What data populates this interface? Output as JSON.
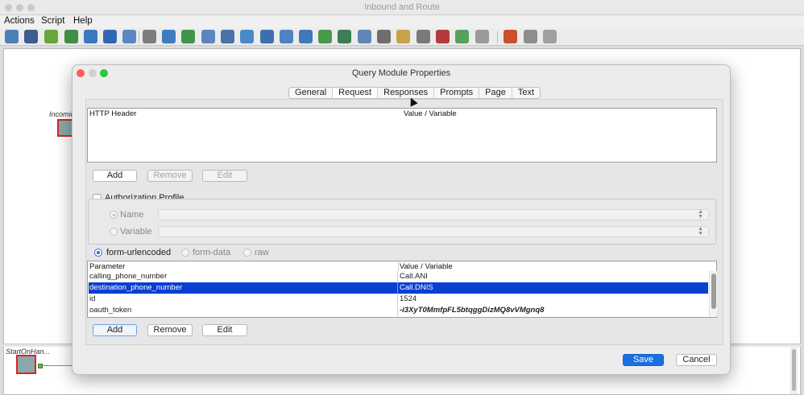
{
  "window": {
    "title": "Inbound and Route"
  },
  "menu": {
    "actions": "Actions",
    "script": "Script",
    "help": "Help"
  },
  "canvas": {
    "node_top_label": "Incomin",
    "node_bottom_label": "StartOnHan..."
  },
  "dialog": {
    "title": "Query Module Properties",
    "tabs": [
      "General",
      "Request",
      "Responses",
      "Prompts",
      "Page",
      "Text"
    ],
    "active_tab": "Request",
    "header_table": {
      "col1": "HTTP Header",
      "col2": "Value / Variable"
    },
    "header_buttons": {
      "add": "Add",
      "remove": "Remove",
      "edit": "Edit"
    },
    "auth": {
      "label": "Authorization Profile",
      "name_label": "Name",
      "variable_label": "Variable"
    },
    "body_type": {
      "urlencoded": "form-urlencoded",
      "formdata": "form-data",
      "raw": "raw",
      "selected": "form-urlencoded"
    },
    "param_table": {
      "col1": "Parameter",
      "col2": "Value / Variable",
      "rows": [
        {
          "param": "calling_phone_number",
          "value": "Call.ANI"
        },
        {
          "param": "destination_phone_number",
          "value": "Call.DNIS"
        },
        {
          "param": "id",
          "value": "1524"
        },
        {
          "param": "oauth_token",
          "value": "-i3XyT0MmfpFL5btqggDizMQ8vVMgnq8"
        }
      ],
      "selected_row": "destination_phone_number"
    },
    "param_buttons": {
      "add": "Add",
      "remove": "Remove",
      "edit": "Edit"
    },
    "save": "Save",
    "cancel": "Cancel"
  },
  "colors": {
    "selection": "#0a3fd1",
    "primary_button": "#1a6fe0",
    "node_border": "#dd2222"
  }
}
